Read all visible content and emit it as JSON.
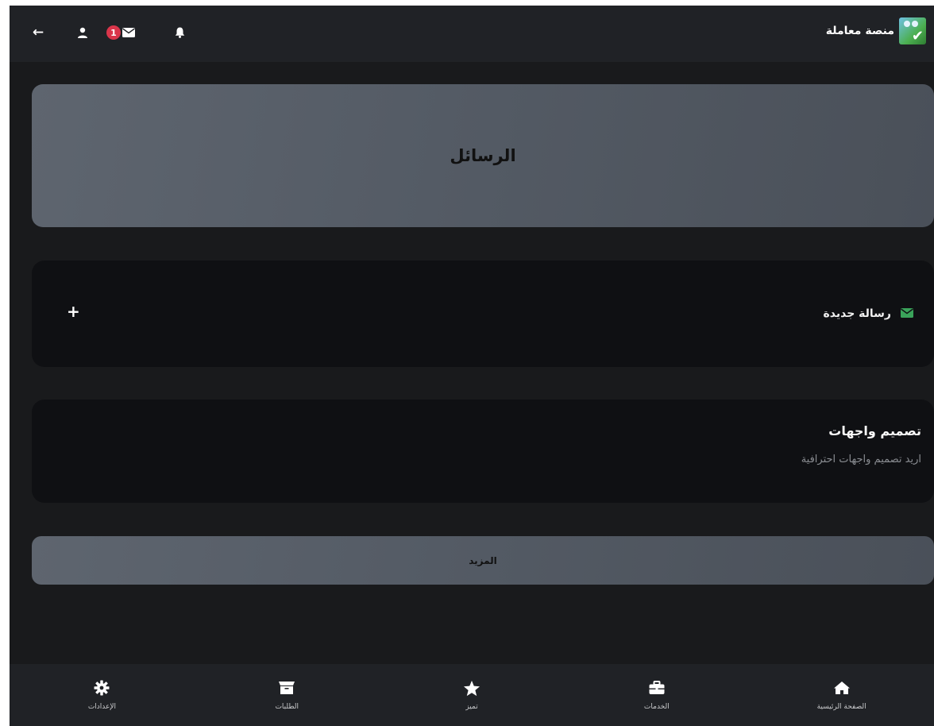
{
  "topbar": {
    "brand_name": "منصة معاملة",
    "mail_badge_count": "1"
  },
  "banner": {
    "title": "الرسائل"
  },
  "new_message": {
    "label": "رسالة جديدة",
    "plus_glyph": "+"
  },
  "conversations": [
    {
      "title": "تصميم واجهات",
      "snippet": "اريد تصميم واجهات احترافية"
    }
  ],
  "more_button": {
    "label": "المزيد"
  },
  "bottom_nav": {
    "items": [
      {
        "label": "الصفحة الرئيسية",
        "icon": "home-icon"
      },
      {
        "label": "الخدمات",
        "icon": "briefcase-icon"
      },
      {
        "label": "تميز",
        "icon": "star-icon"
      },
      {
        "label": "الطلبات",
        "icon": "box-icon"
      },
      {
        "label": "الإعدادات",
        "icon": "gear-icon"
      }
    ]
  },
  "colors": {
    "accent_green": "#3aa35a",
    "badge_red": "#d9354a",
    "background": "#191a1c",
    "card": "#0f1013",
    "banner_gray": "#545b65"
  }
}
